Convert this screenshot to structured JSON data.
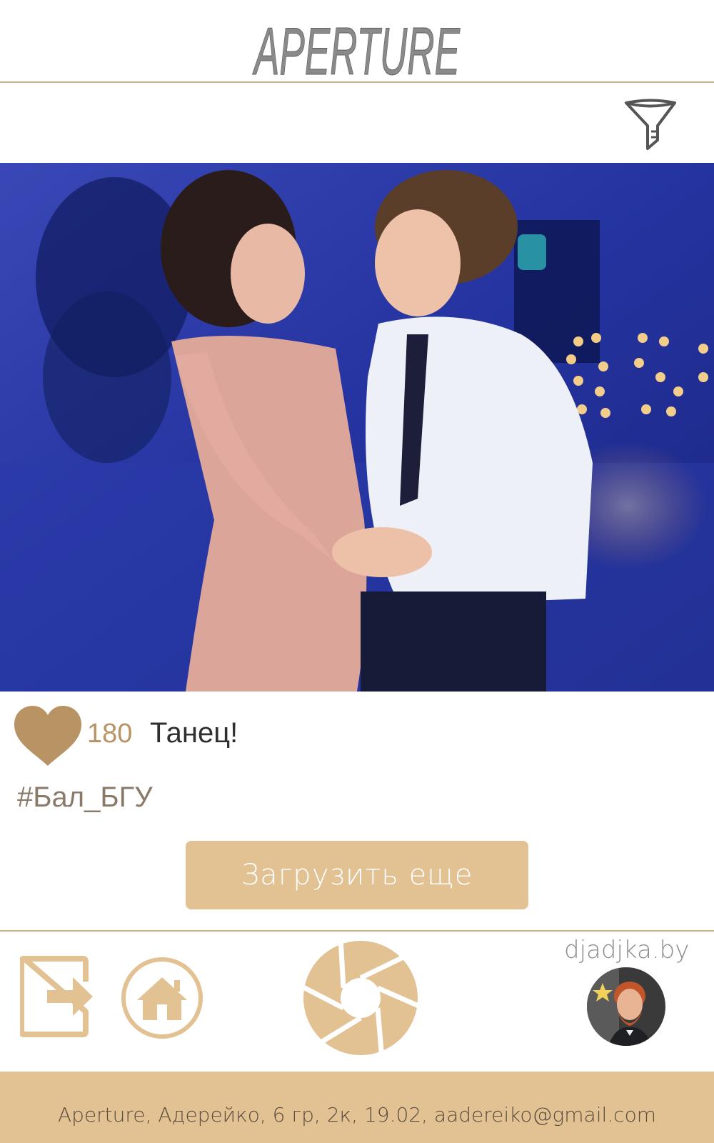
{
  "header": {
    "logo_text": "APERTURE"
  },
  "toolbar": {
    "filter_icon": "filter-funnel-icon"
  },
  "post": {
    "likes": "180",
    "title": "Танец!",
    "hashtag": "#Бал_БГУ",
    "like_icon": "heart-icon"
  },
  "actions": {
    "load_more_label": "Загрузить еще"
  },
  "nav": {
    "site_link": "djadjka.by",
    "logout_icon": "logout-icon",
    "home_icon": "home-icon",
    "aperture_icon": "aperture-icon",
    "avatar_icon": "avatar"
  },
  "footer": {
    "text": "Aperture, Адерейко, 6 гр, 2к, 19.02, aadereiko@gmail.com"
  },
  "colors": {
    "accent": "#e2c192",
    "heart": "#b89363",
    "divider": "#c8b08a"
  }
}
